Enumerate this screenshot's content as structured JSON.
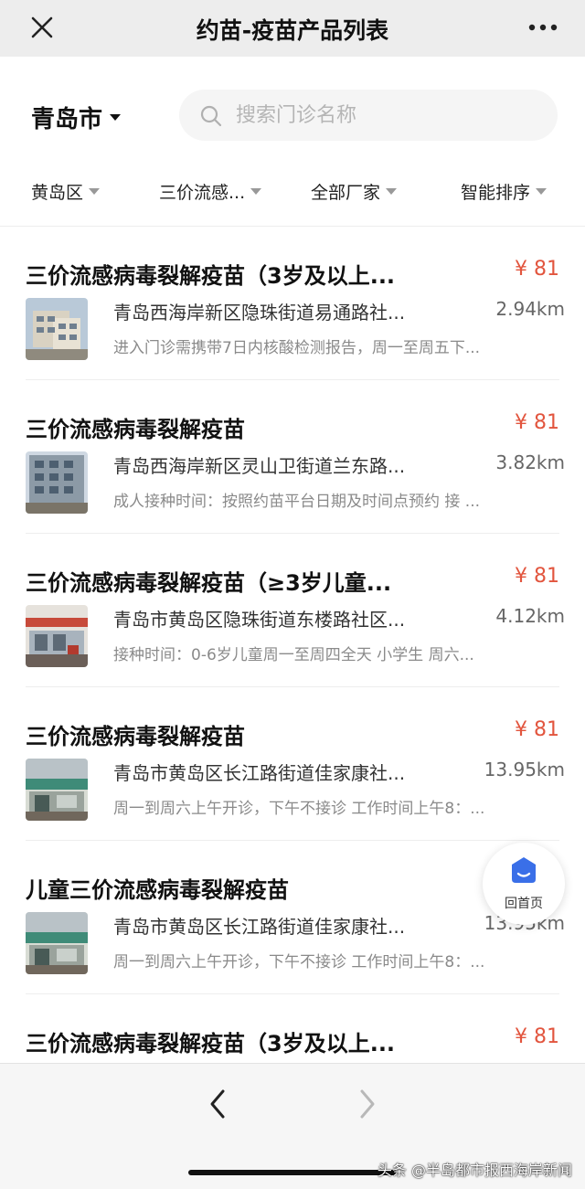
{
  "header": {
    "title": "约苗-疫苗产品列表"
  },
  "search": {
    "city": "青岛市",
    "placeholder": "搜索门诊名称"
  },
  "filters": [
    {
      "label": "黄岛区"
    },
    {
      "label": "三价流感..."
    },
    {
      "label": "全部厂家"
    },
    {
      "label": "智能排序"
    }
  ],
  "items": [
    {
      "name": "三价流感病毒裂解疫苗（3岁及以上...",
      "price": "¥ 81",
      "address": "青岛西海岸新区隐珠街道易通路社...",
      "distance": "2.94km",
      "note": "进入门诊需携带7日内核酸检测报告，周一至周五下..."
    },
    {
      "name": "三价流感病毒裂解疫苗",
      "price": "¥ 81",
      "address": "青岛西海岸新区灵山卫街道兰东路...",
      "distance": "3.82km",
      "note": "成人接种时间：按照约苗平台日期及时间点预约 接 ..."
    },
    {
      "name": "三价流感病毒裂解疫苗（≥3岁儿童...",
      "price": "¥ 81",
      "address": "青岛市黄岛区隐珠街道东楼路社区...",
      "distance": "4.12km",
      "note": "接种时间：0-6岁儿童周一至周四全天 小学生 周六..."
    },
    {
      "name": "三价流感病毒裂解疫苗",
      "price": "¥ 81",
      "address": "青岛市黄岛区长江路街道佳家康社...",
      "distance": "13.95km",
      "note": "周一到周六上午开诊，下午不接诊 工作时间上午8：..."
    },
    {
      "name": "儿童三价流感病毒裂解疫苗",
      "price": "",
      "address": "青岛市黄岛区长江路街道佳家康社...",
      "distance": "13.95km",
      "note": "周一到周六上午开诊，下午不接诊 工作时间上午8：..."
    },
    {
      "name": "三价流感病毒裂解疫苗（3岁及以上...",
      "price": "¥ 81",
      "address": "",
      "distance": "",
      "note": ""
    }
  ],
  "home_button": {
    "label": "回首页"
  },
  "watermark": "头条 @半岛都市报西海岸新闻",
  "colors": {
    "accent_price": "#e2553e",
    "home_icon": "#3a6fe8",
    "topbar_bg": "#ededed"
  }
}
